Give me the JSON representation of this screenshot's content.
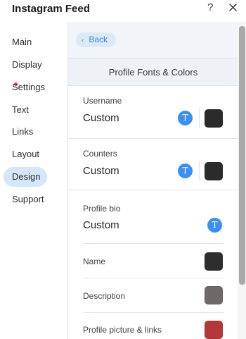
{
  "window": {
    "title": "Instagram Feed",
    "help_label": "?"
  },
  "sidebar": {
    "items": [
      {
        "label": "Main"
      },
      {
        "label": "Display",
        "has_indicator": true
      },
      {
        "label": "Settings"
      },
      {
        "label": "Text"
      },
      {
        "label": "Links"
      },
      {
        "label": "Layout"
      },
      {
        "label": "Design",
        "active": true
      },
      {
        "label": "Support"
      }
    ]
  },
  "panel": {
    "back_label": "Back",
    "section_title": "Profile Fonts & Colors",
    "rows": [
      {
        "label": "Username",
        "value": "Custom",
        "color": "#2b2b2b"
      },
      {
        "label": "Counters",
        "value": "Custom",
        "color": "#2b2b2b"
      },
      {
        "label": "Profile bio",
        "value": "Custom"
      },
      {
        "label": "Name",
        "color": "#2e2e2e"
      },
      {
        "label": "Description",
        "color": "#6e6868"
      },
      {
        "label": "Profile picture & links",
        "color": "#b33838"
      }
    ],
    "font_button_glyph": "T"
  },
  "colors": {
    "accent": "#3b8ff0",
    "active_nav": "#d4e6f7",
    "indicator": "#e8384f"
  }
}
